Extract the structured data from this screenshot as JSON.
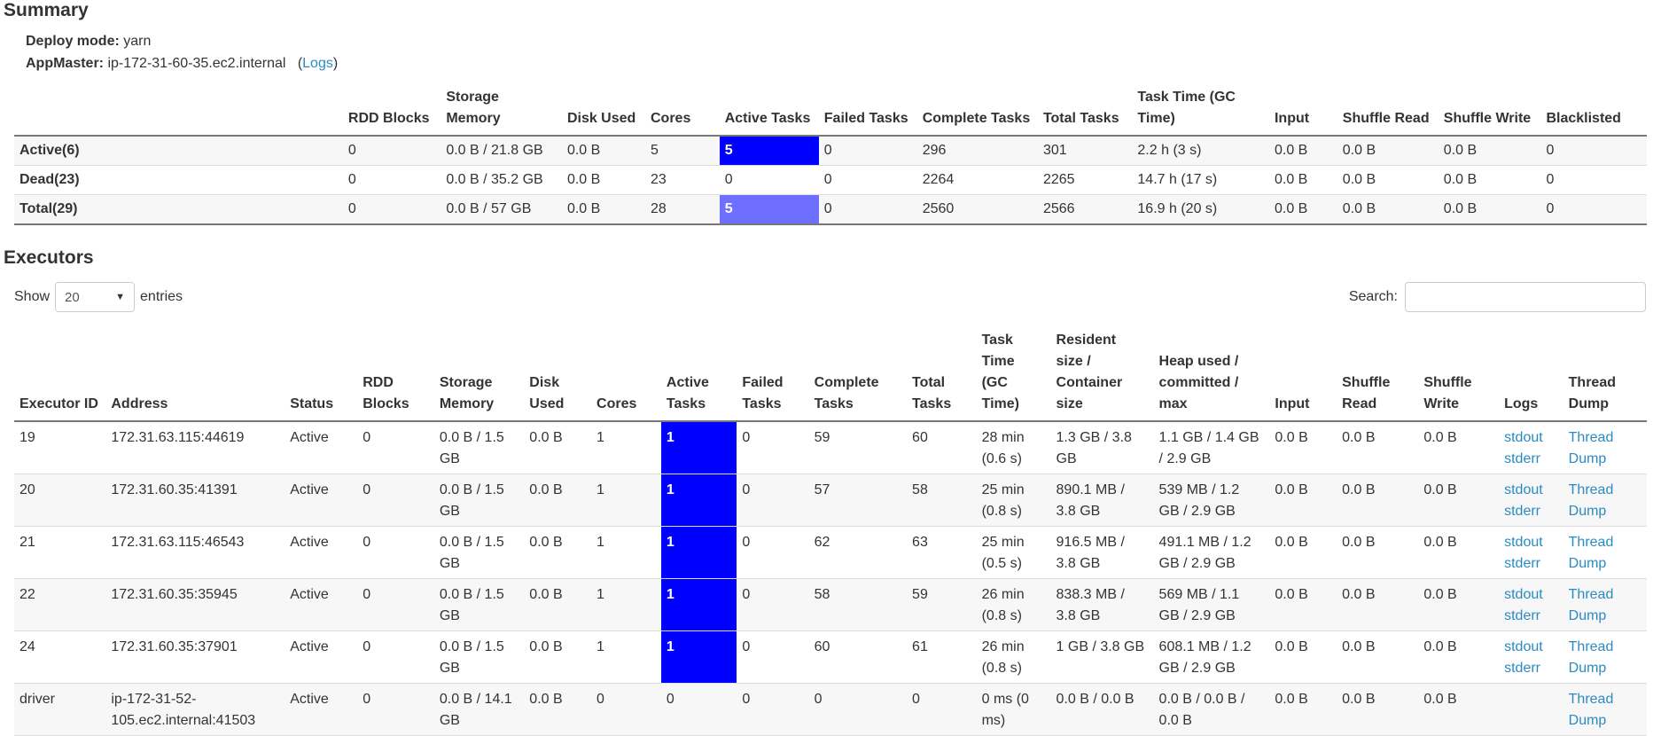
{
  "summary": {
    "title": "Summary",
    "deploy_mode_label": "Deploy mode:",
    "deploy_mode_value": "yarn",
    "appmaster_label": "AppMaster:",
    "appmaster_value": "ip-172-31-60-35.ec2.internal",
    "logs_open": "(",
    "logs_link": "Logs",
    "logs_close": ")",
    "headers": [
      "",
      "RDD Blocks",
      "Storage Memory",
      "Disk Used",
      "Cores",
      "Active Tasks",
      "Failed Tasks",
      "Complete Tasks",
      "Total Tasks",
      "Task Time (GC Time)",
      "Input",
      "Shuffle Read",
      "Shuffle Write",
      "Blacklisted"
    ],
    "rows": [
      [
        "Active(6)",
        "0",
        "0.0 B / 21.8 GB",
        "0.0 B",
        "5",
        "5",
        "0",
        "296",
        "301",
        "2.2 h (3 s)",
        "0.0 B",
        "0.0 B",
        "0.0 B",
        "0"
      ],
      [
        "Dead(23)",
        "0",
        "0.0 B / 35.2 GB",
        "0.0 B",
        "23",
        "0",
        "0",
        "2264",
        "2265",
        "14.7 h (17 s)",
        "0.0 B",
        "0.0 B",
        "0.0 B",
        "0"
      ],
      [
        "Total(29)",
        "0",
        "0.0 B / 57 GB",
        "0.0 B",
        "28",
        "5",
        "0",
        "2560",
        "2566",
        "16.9 h (20 s)",
        "0.0 B",
        "0.0 B",
        "0.0 B",
        "0"
      ]
    ],
    "active_task_colors": [
      "#0000ff",
      "",
      "#6f6fff"
    ]
  },
  "executors": {
    "title": "Executors",
    "show_label": "Show",
    "entries_value": "20",
    "entries_label": "entries",
    "search_label": "Search:",
    "search_value": "",
    "headers": [
      "Executor ID",
      "Address",
      "Status",
      "RDD Blocks",
      "Storage Memory",
      "Disk Used",
      "Cores",
      "Active Tasks",
      "Failed Tasks",
      "Complete Tasks",
      "Total Tasks",
      "Task Time (GC Time)",
      "Resident size / Container size",
      "Heap used / committed / max",
      "Input",
      "Shuffle Read",
      "Shuffle Write",
      "Logs",
      "Thread Dump"
    ],
    "rows": [
      {
        "id": "19",
        "address": "172.31.63.115:44619",
        "status": "Active",
        "rdd": "0",
        "storage": "0.0 B / 1.5 GB",
        "disk": "0.0 B",
        "cores": "1",
        "active": "1",
        "failed": "0",
        "complete": "59",
        "total": "60",
        "tasktime": "28 min (0.6 s)",
        "resident": "1.3 GB / 3.8 GB",
        "heap": "1.1 GB / 1.4 GB / 2.9 GB",
        "input": "0.0 B",
        "sread": "0.0 B",
        "swrite": "0.0 B",
        "stdout": "stdout",
        "stderr": "stderr",
        "thread": "Thread Dump"
      },
      {
        "id": "20",
        "address": "172.31.60.35:41391",
        "status": "Active",
        "rdd": "0",
        "storage": "0.0 B / 1.5 GB",
        "disk": "0.0 B",
        "cores": "1",
        "active": "1",
        "failed": "0",
        "complete": "57",
        "total": "58",
        "tasktime": "25 min (0.8 s)",
        "resident": "890.1 MB / 3.8 GB",
        "heap": "539 MB / 1.2 GB / 2.9 GB",
        "input": "0.0 B",
        "sread": "0.0 B",
        "swrite": "0.0 B",
        "stdout": "stdout",
        "stderr": "stderr",
        "thread": "Thread Dump"
      },
      {
        "id": "21",
        "address": "172.31.63.115:46543",
        "status": "Active",
        "rdd": "0",
        "storage": "0.0 B / 1.5 GB",
        "disk": "0.0 B",
        "cores": "1",
        "active": "1",
        "failed": "0",
        "complete": "62",
        "total": "63",
        "tasktime": "25 min (0.5 s)",
        "resident": "916.5 MB / 3.8 GB",
        "heap": "491.1 MB / 1.2 GB / 2.9 GB",
        "input": "0.0 B",
        "sread": "0.0 B",
        "swrite": "0.0 B",
        "stdout": "stdout",
        "stderr": "stderr",
        "thread": "Thread Dump"
      },
      {
        "id": "22",
        "address": "172.31.60.35:35945",
        "status": "Active",
        "rdd": "0",
        "storage": "0.0 B / 1.5 GB",
        "disk": "0.0 B",
        "cores": "1",
        "active": "1",
        "failed": "0",
        "complete": "58",
        "total": "59",
        "tasktime": "26 min (0.8 s)",
        "resident": "838.3 MB / 3.8 GB",
        "heap": "569 MB / 1.1 GB / 2.9 GB",
        "input": "0.0 B",
        "sread": "0.0 B",
        "swrite": "0.0 B",
        "stdout": "stdout",
        "stderr": "stderr",
        "thread": "Thread Dump"
      },
      {
        "id": "24",
        "address": "172.31.60.35:37901",
        "status": "Active",
        "rdd": "0",
        "storage": "0.0 B / 1.5 GB",
        "disk": "0.0 B",
        "cores": "1",
        "active": "1",
        "failed": "0",
        "complete": "60",
        "total": "61",
        "tasktime": "26 min (0.8 s)",
        "resident": "1 GB / 3.8 GB",
        "heap": "608.1 MB / 1.2 GB / 2.9 GB",
        "input": "0.0 B",
        "sread": "0.0 B",
        "swrite": "0.0 B",
        "stdout": "stdout",
        "stderr": "stderr",
        "thread": "Thread Dump"
      },
      {
        "id": "driver",
        "address": "ip-172-31-52-105.ec2.internal:41503",
        "status": "Active",
        "rdd": "0",
        "storage": "0.0 B / 14.1 GB",
        "disk": "0.0 B",
        "cores": "0",
        "active": "0",
        "failed": "0",
        "complete": "0",
        "total": "0",
        "tasktime": "0 ms (0 ms)",
        "resident": "0.0 B / 0.0 B",
        "heap": "0.0 B / 0.0 B / 0.0 B",
        "input": "0.0 B",
        "sread": "0.0 B",
        "swrite": "0.0 B",
        "stdout": "",
        "stderr": "",
        "thread": "Thread Dump"
      }
    ],
    "active_color": "#0000ff"
  }
}
